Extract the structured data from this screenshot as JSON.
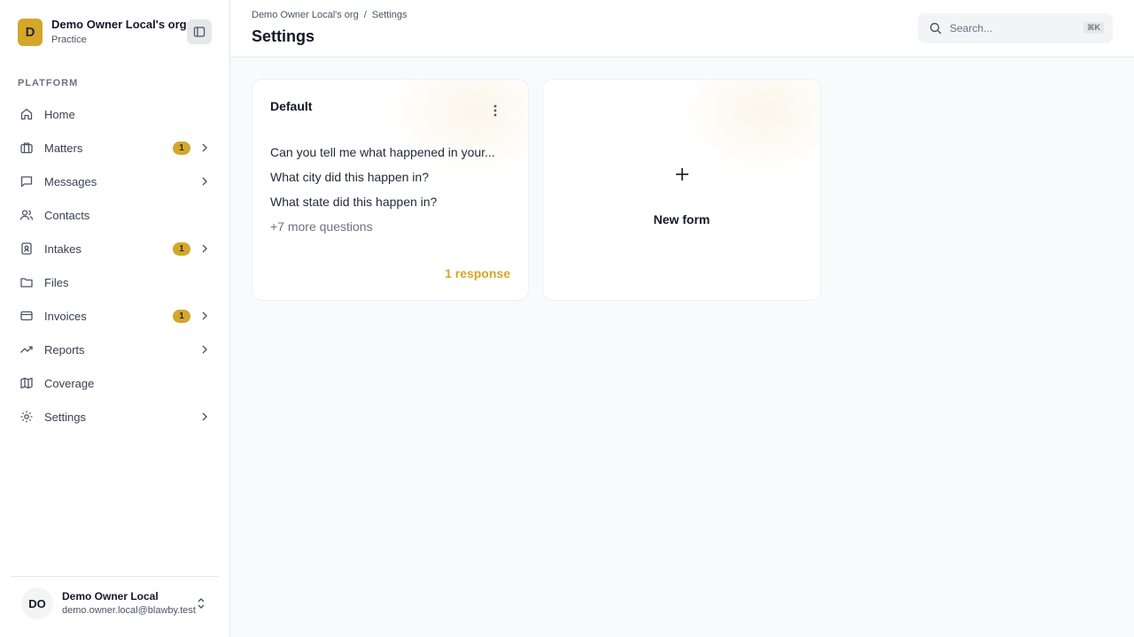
{
  "org": {
    "initial": "D",
    "name": "Demo Owner Local's org",
    "subtitle": "Practice"
  },
  "sidebar": {
    "section_label": "PLATFORM",
    "items": [
      {
        "label": "Home",
        "icon": "home-icon",
        "badge": null,
        "chevron": false
      },
      {
        "label": "Matters",
        "icon": "briefcase-icon",
        "badge": "1",
        "chevron": true
      },
      {
        "label": "Messages",
        "icon": "message-square-icon",
        "badge": null,
        "chevron": true
      },
      {
        "label": "Contacts",
        "icon": "users-icon",
        "badge": null,
        "chevron": false
      },
      {
        "label": "Intakes",
        "icon": "contact-card-icon",
        "badge": "1",
        "chevron": true
      },
      {
        "label": "Files",
        "icon": "folder-icon",
        "badge": null,
        "chevron": false
      },
      {
        "label": "Invoices",
        "icon": "credit-card-icon",
        "badge": "1",
        "chevron": true
      },
      {
        "label": "Reports",
        "icon": "trending-up-icon",
        "badge": null,
        "chevron": true
      },
      {
        "label": "Coverage",
        "icon": "map-icon",
        "badge": null,
        "chevron": false
      },
      {
        "label": "Settings",
        "icon": "gear-icon",
        "badge": null,
        "chevron": true
      }
    ]
  },
  "user": {
    "initials": "DO",
    "name": "Demo Owner Local",
    "email": "demo.owner.local@blawby.test"
  },
  "header": {
    "breadcrumb": [
      "Demo Owner Local's org",
      "Settings"
    ],
    "breadcrumb_separator": "/",
    "title": "Settings",
    "search_placeholder": "Search...",
    "search_shortcut": "⌘K"
  },
  "forms": {
    "default_card": {
      "title": "Default",
      "questions": [
        "Can you tell me what happened in your...",
        "What city did this happen in?",
        "What state did this happen in?"
      ],
      "more": "+7 more questions",
      "responses": "1 response"
    },
    "new_card": {
      "label": "New form"
    }
  },
  "colors": {
    "accent": "#d4a62a",
    "sidebar_bg": "#ffffff",
    "page_bg": "#f9fafb"
  }
}
